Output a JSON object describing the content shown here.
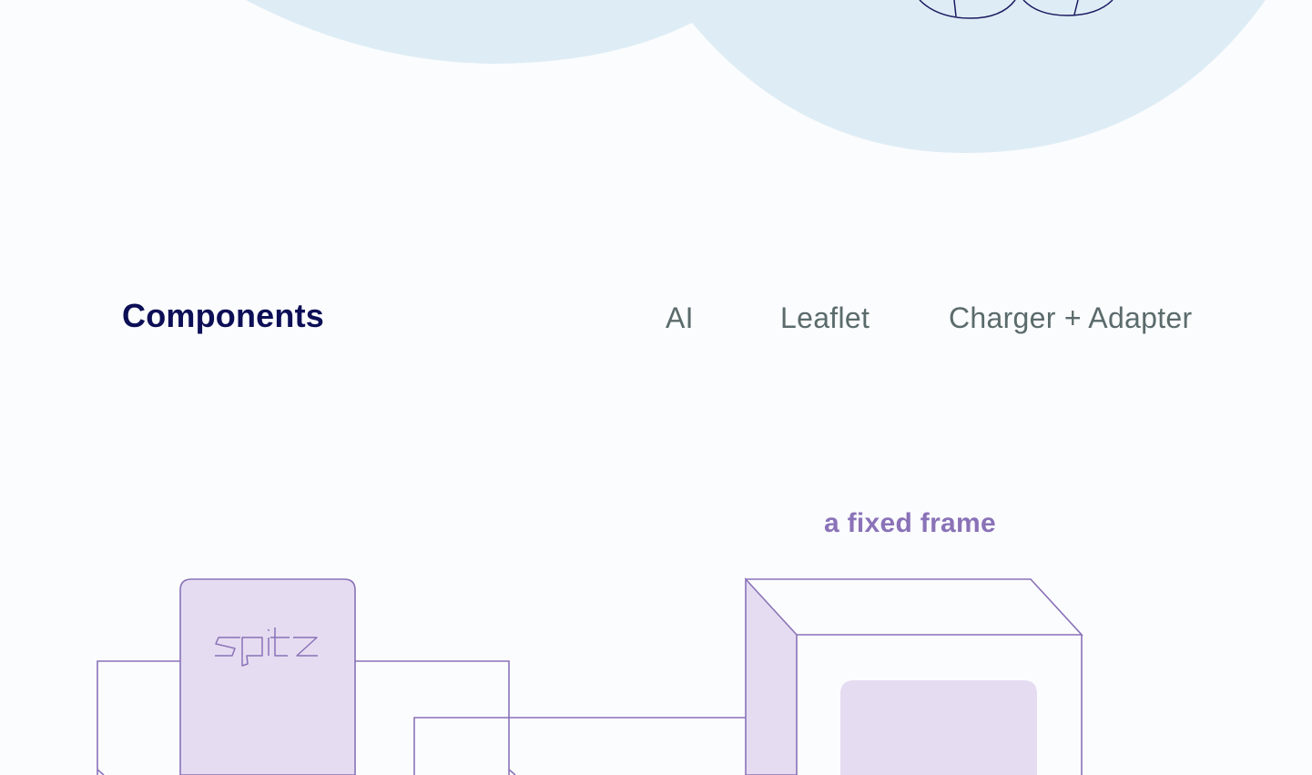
{
  "nav": {
    "title": "Components",
    "links": [
      {
        "label": "AI"
      },
      {
        "label": "Leaflet"
      },
      {
        "label": "Charger + Adapter"
      }
    ]
  },
  "caption": "a fixed frame",
  "device": {
    "logo_text": "spitz"
  },
  "colors": {
    "page_bg": "#fbfcfe",
    "cloud": "#deedf5",
    "title": "#0d0f56",
    "link": "#5b6b6b",
    "accent": "#8a72b8",
    "fill": "#e5dcf1"
  }
}
